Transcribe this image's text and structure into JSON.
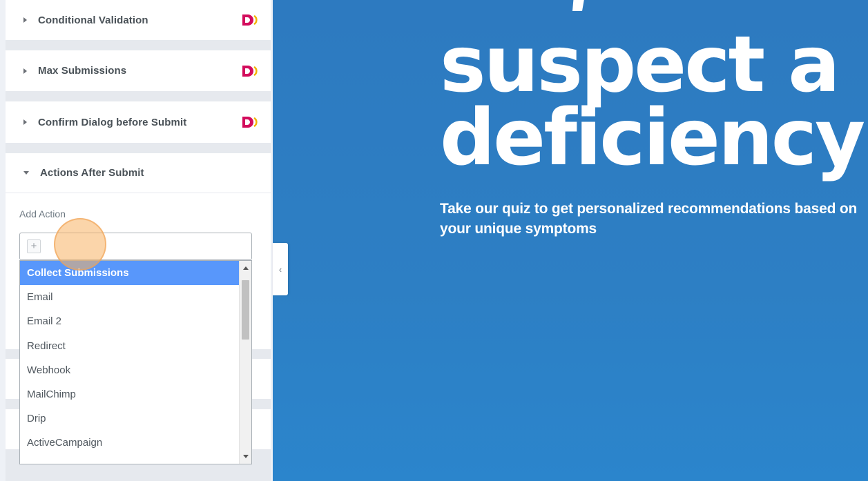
{
  "panel": {
    "sections": [
      {
        "title": "Conditional Validation",
        "expanded": false,
        "pro": true
      },
      {
        "title": "Max Submissions",
        "expanded": false,
        "pro": true
      },
      {
        "title": "Confirm Dialog before Submit",
        "expanded": false,
        "pro": true
      },
      {
        "title": "Actions After Submit",
        "expanded": true,
        "pro": false
      }
    ],
    "add_action_label": "Add Action",
    "add_button_glyph": "+",
    "dropdown_options": [
      {
        "label": "Collect Submissions",
        "selected": true
      },
      {
        "label": "Email",
        "selected": false
      },
      {
        "label": "Email 2",
        "selected": false
      },
      {
        "label": "Redirect",
        "selected": false
      },
      {
        "label": "Webhook",
        "selected": false
      },
      {
        "label": "MailChimp",
        "selected": false
      },
      {
        "label": "Drip",
        "selected": false
      },
      {
        "label": "ActiveCampaign",
        "selected": false
      }
    ],
    "collapse_glyph": "‹"
  },
  "preview": {
    "headline_line1": "suspect a",
    "headline_line2": "deficiency?",
    "subtext": "Take our quiz to get personalized recommendations based on your unique symptoms"
  },
  "colors": {
    "preview_bg": "#2d7ac0",
    "selected_option": "#5897fb",
    "pro_badge": "#d30c5c",
    "cursor_highlight": "#f7b264"
  }
}
